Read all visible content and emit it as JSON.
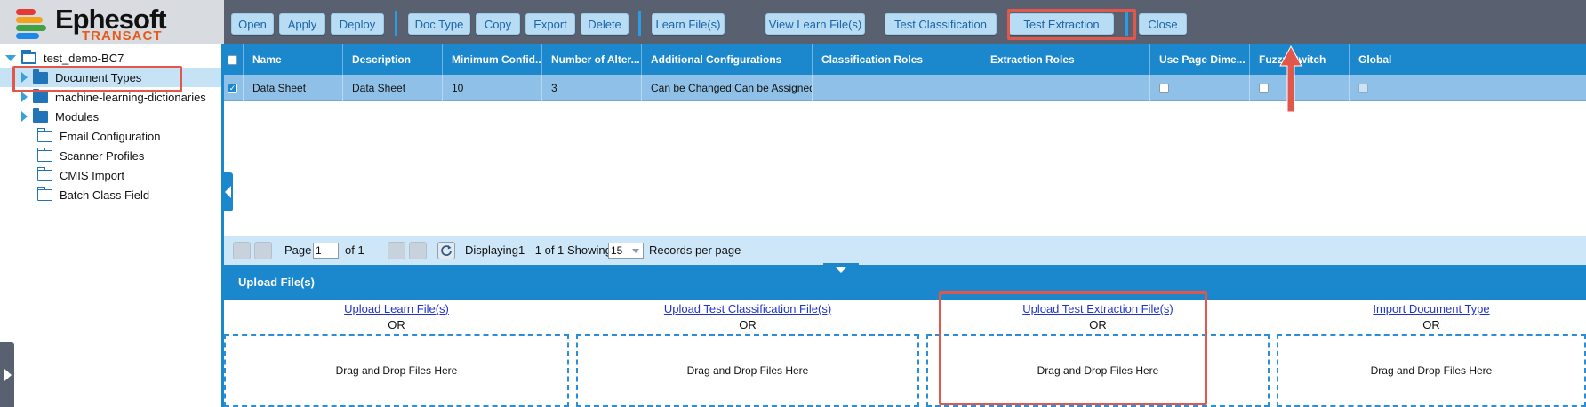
{
  "app": {
    "logo_name": "Ephesoft",
    "logo_sub": "TRANSACT",
    "logo_colors": [
      "#e53935",
      "#f4a11c",
      "#43a047",
      "#1e88e5"
    ]
  },
  "tree": {
    "root": "test_demo-BC7",
    "items": [
      {
        "label": "Document Types",
        "expandable": true,
        "icon": "folder-icon"
      },
      {
        "label": "machine-learning-dictionaries",
        "expandable": true,
        "icon": "folder-icon"
      },
      {
        "label": "Modules",
        "expandable": true,
        "icon": "folder-icon"
      },
      {
        "label": "Email Configuration",
        "expandable": false,
        "icon": "folder-outline-icon"
      },
      {
        "label": "Scanner Profiles",
        "expandable": false,
        "icon": "folder-outline-icon"
      },
      {
        "label": "CMIS Import",
        "expandable": false,
        "icon": "folder-outline-icon"
      },
      {
        "label": "Batch Class Field",
        "expandable": false,
        "icon": "folder-outline-icon"
      }
    ]
  },
  "toolbar": {
    "open": "Open",
    "apply": "Apply",
    "deploy": "Deploy",
    "doc_type": "Doc Type",
    "copy": "Copy",
    "export": "Export",
    "delete": "Delete",
    "learn_files": "Learn File(s)",
    "view_learn_files": "View Learn File(s)",
    "test_classification": "Test Classification",
    "test_extraction": "Test Extraction",
    "close": "Close"
  },
  "grid": {
    "columns": [
      "Name",
      "Description",
      "Minimum Confid...",
      "Number of Alter...",
      "Additional Configurations",
      "Classification Roles",
      "Extraction Roles",
      "Use Page Dime...",
      "Fuzzy Switch",
      "Global"
    ],
    "rows": [
      {
        "name": "Data Sheet",
        "description": "Data Sheet",
        "min_confidence": "10",
        "num_alternates": "3",
        "additional_configurations": "Can be Changed;Can be Assigned",
        "classification_roles": "",
        "extraction_roles": "",
        "checked": true
      }
    ]
  },
  "pager": {
    "page_label": "Page",
    "page_value": "1",
    "of_label": "of 1",
    "displaying": "Displaying1 - 1 of 1",
    "showing_label": "Showing",
    "per_page_value": "15",
    "records_label": "Records per page"
  },
  "upload": {
    "title": "Upload File(s)",
    "or_label": "OR",
    "drop_label": "Drag and Drop Files Here",
    "columns": [
      "Upload Learn File(s)",
      "Upload Test Classification File(s)",
      "Upload Test Extraction File(s)",
      "Import Document Type"
    ]
  },
  "colors": {
    "accent": "#1b87cc",
    "toolbar_bg": "#596170",
    "highlight": "#e2574c",
    "link": "#2234c8"
  }
}
